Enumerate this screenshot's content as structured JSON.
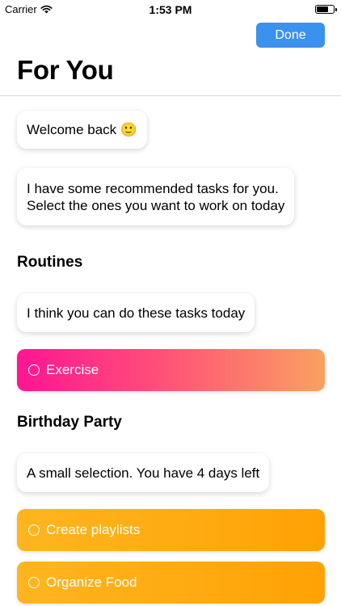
{
  "status_bar": {
    "carrier": "Carrier",
    "time": "1:53 PM",
    "battery_level": 0.7
  },
  "nav": {
    "done_label": "Done",
    "title": "For You"
  },
  "messages": {
    "welcome": "Welcome back 🙂",
    "intro_line1": "I have some recommended tasks for you.",
    "intro_line2": "Select the ones you want to work on today"
  },
  "sections": [
    {
      "title": "Routines",
      "message": "I think you can do these tasks today",
      "tasks": [
        {
          "label": "Exercise",
          "checked": false
        }
      ]
    },
    {
      "title": "Birthday Party",
      "message": "A small selection. You have 4 days left",
      "tasks": [
        {
          "label": "Create playlists",
          "checked": false
        },
        {
          "label": "Organize Food",
          "checked": false
        }
      ]
    }
  ],
  "colors": {
    "accent": "#3a91ee",
    "routine_gradient": [
      "#ff1493",
      "#faa15e"
    ],
    "party_gradient": [
      "#ffb51f",
      "#ffa205"
    ]
  },
  "icons": {
    "wifi": "wifi-icon",
    "battery": "battery-icon",
    "task_check": "circle-outline-icon"
  }
}
